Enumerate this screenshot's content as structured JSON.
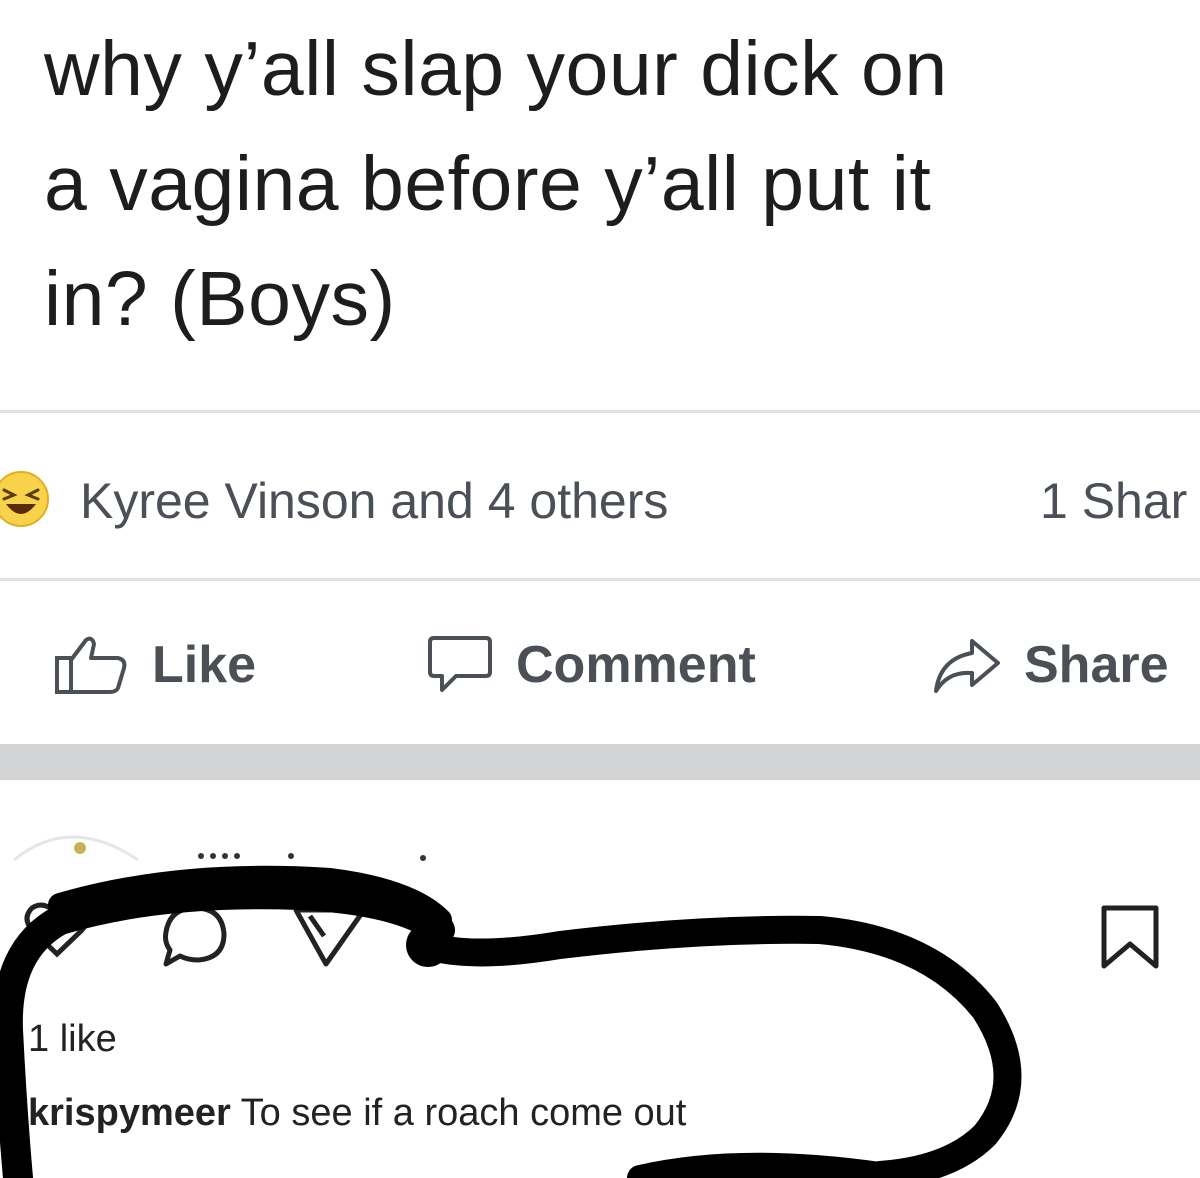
{
  "post": {
    "text_lines": [
      "why y’all slap your dick on",
      "a vagina before y’all put it",
      "in? (Boys)"
    ]
  },
  "reactions": {
    "icon": "haha-emoji-icon",
    "text": "Kyree Vinson and 4 others",
    "shares": "1 Shar"
  },
  "actions": {
    "like_label": "Like",
    "comment_label": "Comment",
    "share_label": "Share"
  },
  "instagram": {
    "icons": [
      "heart-icon",
      "comment-bubble-icon",
      "send-icon",
      "bookmark-icon"
    ],
    "likes": "1 like",
    "comment": {
      "username": "krispymeer",
      "text": " To see if a roach come out"
    }
  },
  "colors": {
    "background": "#ffffff",
    "divider": "#e2e2e2",
    "band": "#d3d4d6",
    "action_text": "#4b4f56",
    "scribble": "#000000"
  }
}
